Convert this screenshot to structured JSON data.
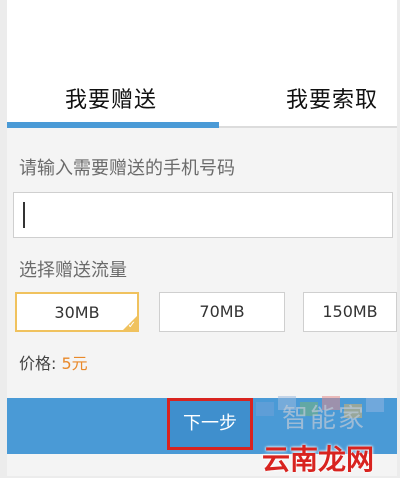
{
  "tabs": {
    "active_label": "我要赠送",
    "inactive_label": "我要索取"
  },
  "phone": {
    "label": "请输入需要赠送的手机号码",
    "value": ""
  },
  "flow": {
    "label": "选择赠送流量",
    "options": [
      "30MB",
      "70MB",
      "150MB"
    ],
    "selected": "30MB"
  },
  "price": {
    "label": "价格:",
    "value": "5元"
  },
  "next_button": {
    "label": "下一步"
  },
  "watermark": {
    "brand": "云南龙网",
    "text": "智能家"
  },
  "colors": {
    "accent": "#4a9ad6",
    "selected_border": "#f0c25e",
    "price": "#e9892a",
    "highlight": "#d8231f"
  }
}
